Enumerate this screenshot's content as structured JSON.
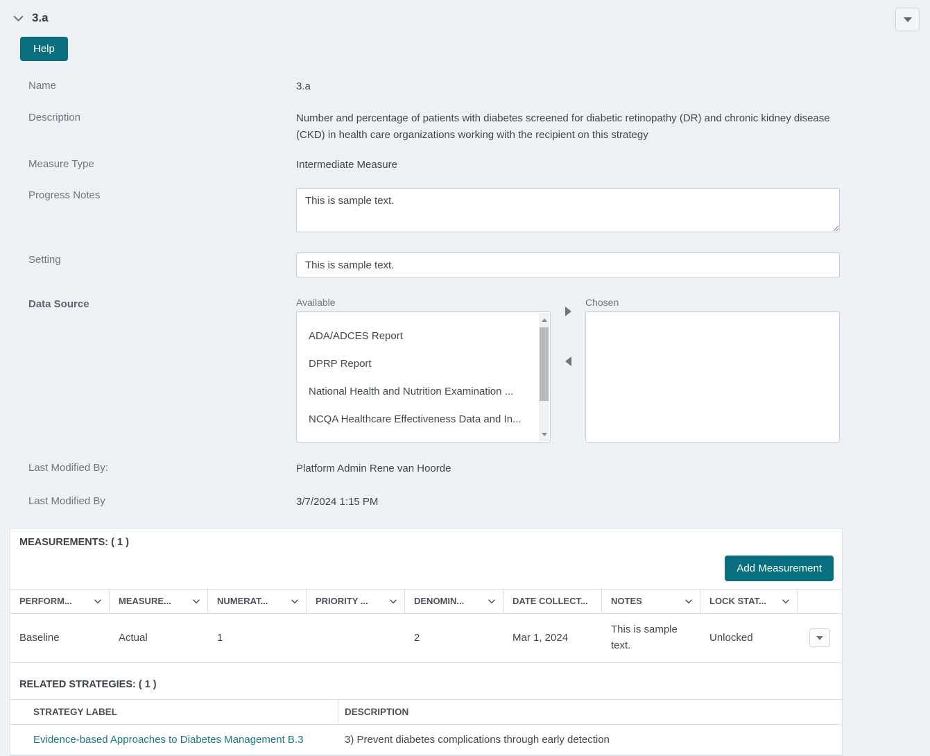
{
  "header": {
    "title": "3.a",
    "help_button": "Help"
  },
  "form": {
    "name": {
      "label": "Name",
      "value": "3.a"
    },
    "description": {
      "label": "Description",
      "value": "Number and percentage of patients with diabetes screened for diabetic retinopathy (DR) and chronic kidney disease (CKD) in health care organizations working with the recipient on this strategy"
    },
    "measure_type": {
      "label": "Measure Type",
      "value": "Intermediate Measure"
    },
    "progress_notes": {
      "label": "Progress Notes",
      "value": "This is sample text."
    },
    "setting": {
      "label": "Setting",
      "value": "This is sample text."
    },
    "data_source": {
      "label": "Data Source",
      "available_label": "Available",
      "chosen_label": "Chosen",
      "available_items": [
        "ADA/ADCES Report",
        "DPRP Report",
        "National Health and Nutrition Examination ...",
        "NCQA Healthcare Effectiveness Data and In..."
      ],
      "chosen_items": []
    },
    "last_modified_by": {
      "label": "Last Modified By:",
      "value": "Platform Admin Rene van Hoorde"
    },
    "last_modified_date": {
      "label": "Last Modified By",
      "value": "3/7/2024 1:15 PM"
    }
  },
  "measurements": {
    "title": "MEASUREMENTS: ( 1 )",
    "add_button": "Add Measurement",
    "columns": [
      {
        "label": "PERFORM..."
      },
      {
        "label": "MEASURE..."
      },
      {
        "label": "NUMERAT..."
      },
      {
        "label": "PRIORITY ..."
      },
      {
        "label": "DENOMIN..."
      },
      {
        "label": "DATE COLLECT..."
      },
      {
        "label": "NOTES"
      },
      {
        "label": "LOCK STAT..."
      }
    ],
    "rows": [
      {
        "performance": "Baseline",
        "measure": "Actual",
        "numerator": "1",
        "priority": "",
        "denominator": "2",
        "date_collected": "Mar 1, 2024",
        "notes": "This is sample text.",
        "lock_status": "Unlocked"
      }
    ]
  },
  "related_strategies": {
    "title": "RELATED STRATEGIES: ( 1 )",
    "columns": {
      "label": "STRATEGY LABEL",
      "description": "DESCRIPTION"
    },
    "rows": [
      {
        "label": "Evidence-based Approaches to Diabetes Management B.3",
        "description": "3) Prevent diabetes complications through early detection"
      }
    ]
  },
  "colors": {
    "accent_teal": "#096e7d",
    "link_teal": "#16788a",
    "page_bg": "#edf1f5"
  }
}
